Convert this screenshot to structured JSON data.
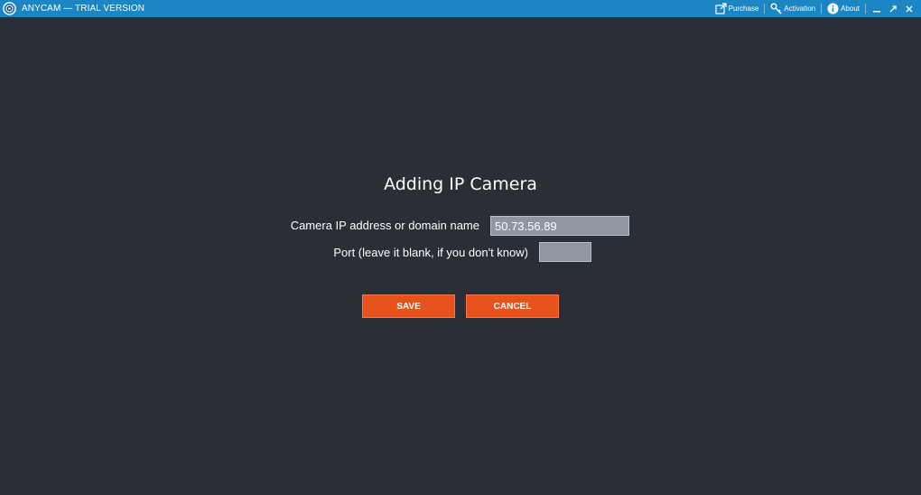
{
  "window": {
    "title": "ANYCAM — TRIAL VERSION",
    "logo_icon": "anycam-logo-icon"
  },
  "titlebar": {
    "actions": [
      {
        "label": "Purchase",
        "icon": "external-link-icon"
      },
      {
        "label": "Activation",
        "icon": "key-icon"
      },
      {
        "label": "About",
        "icon": "info-icon"
      }
    ],
    "window_controls": [
      "minimize-icon",
      "restore-icon",
      "close-icon"
    ]
  },
  "dialog": {
    "title": "Adding IP Camera",
    "ip_label": "Camera IP address or domain name",
    "ip_value": "50.73.56.89",
    "port_label": "Port (leave it blank, if you don't know)",
    "port_value": "",
    "save_label": "SAVE",
    "cancel_label": "CANCEL"
  },
  "colors": {
    "titlebar": "#1b86c3",
    "background": "#2a2e36",
    "input": "#8e96a1",
    "button": "#e8531d"
  }
}
